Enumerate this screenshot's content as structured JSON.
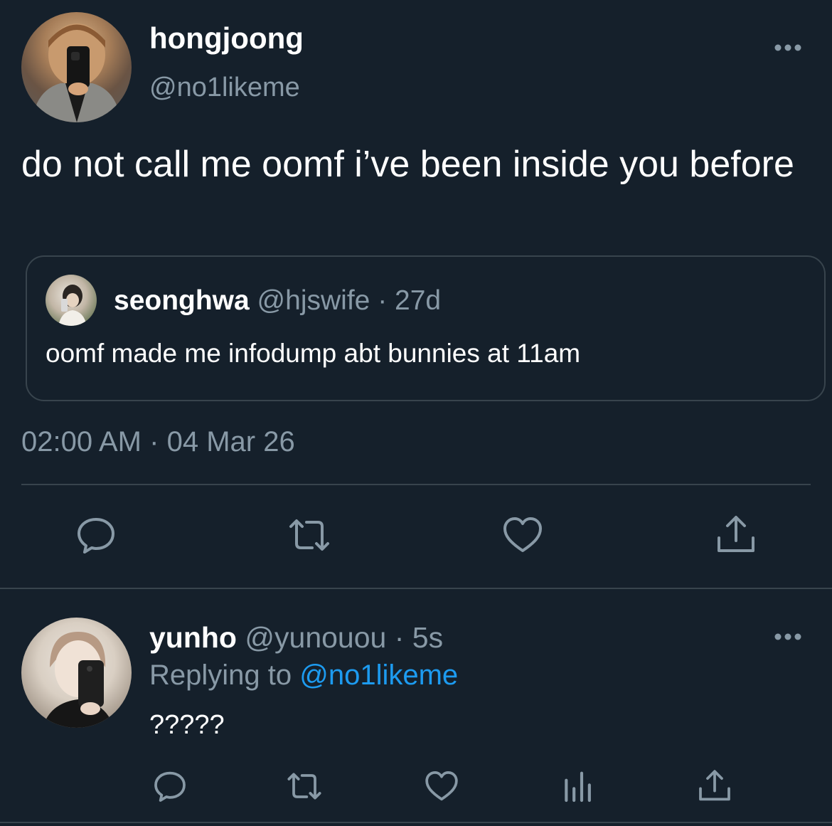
{
  "colors": {
    "background": "#15202b",
    "text_primary": "#ffffff",
    "text_secondary": "#8899a6",
    "link": "#1d9bf0",
    "border": "#38444d"
  },
  "tweet": {
    "display_name": "hongjoong",
    "handle": "@no1likeme",
    "more_icon": "more-horizontal-icon",
    "text": "do not call me oomf i’ve been inside you before",
    "quote": {
      "display_name": "seonghwa",
      "handle": "@hjswife",
      "separator": "·",
      "age": "27d",
      "text": "oomf made me infodump abt bunnies at 11am"
    },
    "time": "02:00 AM",
    "separator": "·",
    "date": "04 Mar 26",
    "actions": [
      "reply-icon",
      "retweet-icon",
      "like-icon",
      "share-icon"
    ]
  },
  "reply": {
    "display_name": "yunho",
    "handle": "@yunouou",
    "separator": "·",
    "age": "5s",
    "more_icon": "more-horizontal-icon",
    "replying_prefix": "Replying to",
    "replying_to": "@no1likeme",
    "text": "?????",
    "actions": [
      "reply-icon",
      "retweet-icon",
      "like-icon",
      "analytics-icon",
      "share-icon"
    ]
  }
}
